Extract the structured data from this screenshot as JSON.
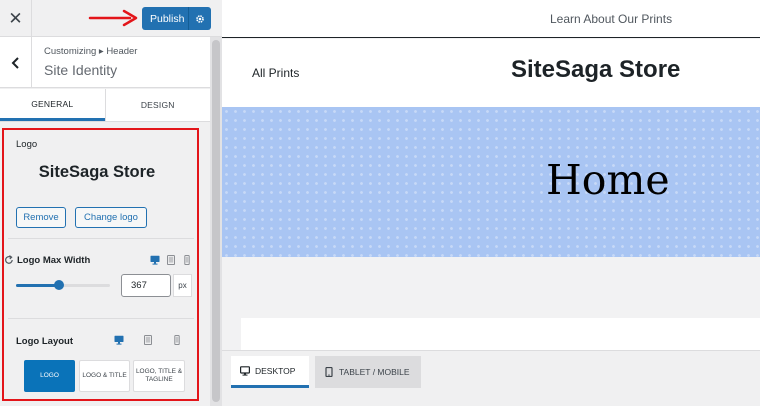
{
  "customizer": {
    "publish_label": "Publish",
    "breadcrumb": "Customizing ▸ Header",
    "section_title": "Site Identity",
    "tabs": [
      "GENERAL",
      "DESIGN"
    ],
    "active_tab": "GENERAL"
  },
  "logo": {
    "label": "Logo",
    "preview_text": "SiteSaga Store",
    "remove_label": "Remove",
    "change_label": "Change logo"
  },
  "logo_max_width": {
    "label": "Logo Max Width",
    "value": "367",
    "unit": "px",
    "slider_fraction": 0.46
  },
  "logo_layout": {
    "label": "Logo Layout",
    "options": [
      "LOGO",
      "LOGO & TITLE",
      "LOGO, TITLE & TAGLINE"
    ],
    "selected": "LOGO"
  },
  "preview": {
    "nav_top_link": "Learn About Our Prints",
    "nav_link": "All Prints",
    "site_title": "SiteSaga Store",
    "hero_title": "Home"
  },
  "devices": {
    "desktop_label": "DESKTOP",
    "tablet_label": "TABLET / MOBILE",
    "active": "DESKTOP"
  },
  "colors": {
    "accent": "#2271b1",
    "highlight": "#e3151a",
    "hero_bg": "#a9c5f3"
  },
  "icons": [
    "close-icon",
    "back-chevron-icon",
    "gear-icon",
    "reset-icon",
    "desktop-icon",
    "tablet-icon",
    "mobile-icon"
  ]
}
